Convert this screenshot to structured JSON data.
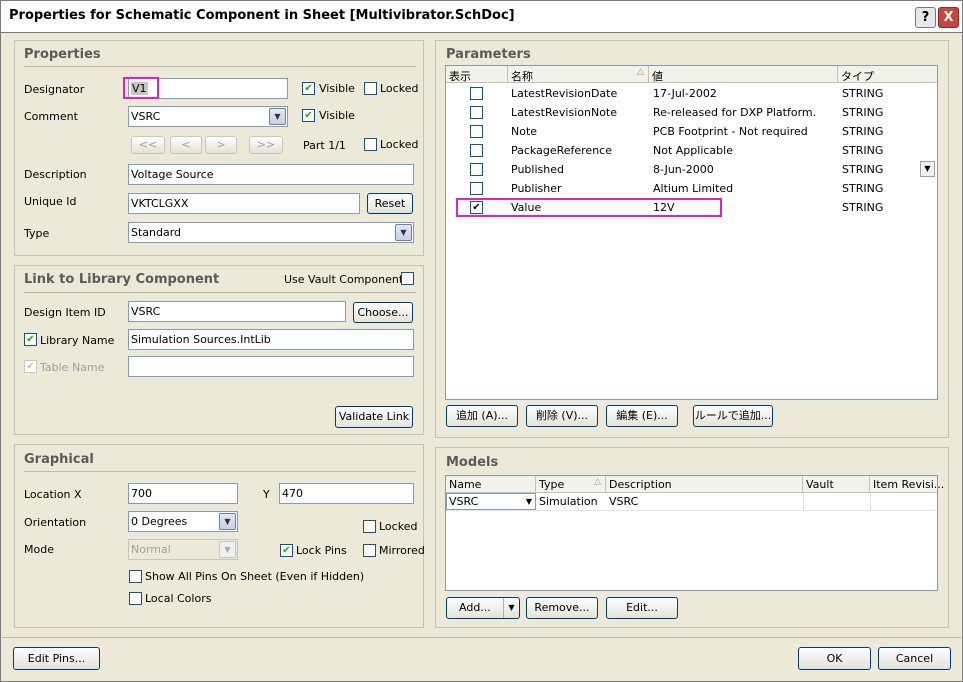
{
  "window": {
    "title": "Properties for Schematic Component in Sheet [Multivibrator.SchDoc]",
    "help_label": "?",
    "close_label": "X"
  },
  "properties": {
    "title": "Properties",
    "designator_label": "Designator",
    "designator_value": "V1",
    "visible_label": "Visible",
    "locked_label": "Locked",
    "comment_label": "Comment",
    "comment_value": "VSRC",
    "comment_visible_label": "Visible",
    "nav_first": "<<",
    "nav_prev": "<",
    "nav_next": ">",
    "nav_last": ">>",
    "part_label": "Part 1/1",
    "part_locked_label": "Locked",
    "description_label": "Description",
    "description_value": "Voltage Source",
    "unique_id_label": "Unique Id",
    "unique_id_value": "VKTCLGXX",
    "reset_label": "Reset",
    "type_label": "Type",
    "type_value": "Standard"
  },
  "library": {
    "title": "Link to Library Component",
    "use_vault_label": "Use Vault Component",
    "design_item_label": "Design Item ID",
    "design_item_value": "VSRC",
    "choose_label": "Choose...",
    "library_name_label": "Library Name",
    "library_name_value": "Simulation Sources.IntLib",
    "table_name_label": "Table Name",
    "table_name_value": "",
    "validate_label": "Validate Link"
  },
  "graphical": {
    "title": "Graphical",
    "location_label": "Location  X",
    "x_value": "700",
    "y_label": "Y",
    "y_value": "470",
    "orientation_label": "Orientation",
    "orientation_value": "0 Degrees",
    "locked_label": "Locked",
    "mode_label": "Mode",
    "mode_value": "Normal",
    "lock_pins_label": "Lock Pins",
    "mirrored_label": "Mirrored",
    "show_all_pins_label": "Show All Pins On Sheet (Even if Hidden)",
    "local_colors_label": "Local Colors"
  },
  "parameters": {
    "title": "Parameters",
    "columns": [
      "表示",
      "名称",
      "値",
      "タイプ"
    ],
    "sort_glyph": "△",
    "rows": [
      {
        "checked": false,
        "name": "LatestRevisionDate",
        "value": "17-Jul-2002",
        "type": "STRING"
      },
      {
        "checked": false,
        "name": "LatestRevisionNote",
        "value": "Re-released for DXP Platform.",
        "type": "STRING"
      },
      {
        "checked": false,
        "name": "Note",
        "value": "PCB Footprint - Not required",
        "type": "STRING"
      },
      {
        "checked": false,
        "name": "PackageReference",
        "value": "Not Applicable",
        "type": "STRING"
      },
      {
        "checked": false,
        "name": "Published",
        "value": "8-Jun-2000",
        "type": "STRING"
      },
      {
        "checked": false,
        "name": "Publisher",
        "value": "Altium Limited",
        "type": "STRING"
      },
      {
        "checked": true,
        "name": "Value",
        "value": "12V",
        "type": "STRING"
      }
    ],
    "add_label": "追加 (A)...",
    "delete_label": "削除 (V)...",
    "edit_label": "編集 (E)...",
    "rule_add_label": "ルールで追加..."
  },
  "models": {
    "title": "Models",
    "columns": [
      "Name",
      "Type",
      "Description",
      "Vault",
      "Item Revisi..."
    ],
    "sort_glyph": "△",
    "rows": [
      {
        "name": "VSRC",
        "type": "Simulation",
        "description": "VSRC",
        "vault": "",
        "item_revision": ""
      }
    ],
    "add_label": "Add...",
    "remove_label": "Remove...",
    "edit_label": "Edit..."
  },
  "footer": {
    "edit_pins_label": "Edit Pins...",
    "ok_label": "OK",
    "cancel_label": "Cancel"
  },
  "icons": {
    "check": "✔",
    "dropdown": "▼"
  }
}
